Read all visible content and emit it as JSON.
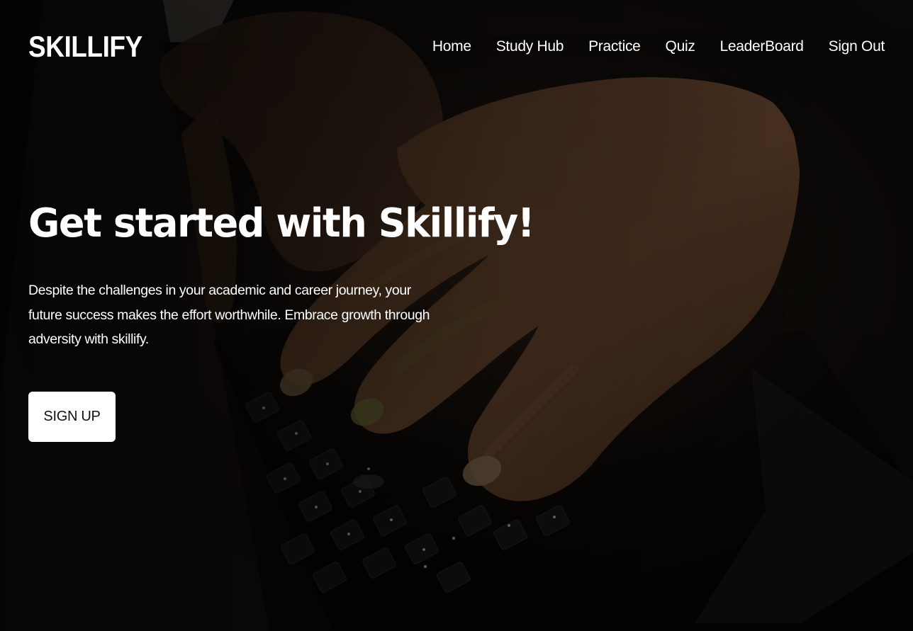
{
  "header": {
    "brand": "SKILLIFY",
    "nav": [
      {
        "label": "Home"
      },
      {
        "label": "Study Hub"
      },
      {
        "label": "Practice"
      },
      {
        "label": "Quiz"
      },
      {
        "label": "LeaderBoard"
      },
      {
        "label": "Sign Out"
      }
    ]
  },
  "hero": {
    "title": "Get started with Skillify!",
    "description": "Despite the challenges in your academic and career journey, your future success makes the effort worthwhile. Embrace growth through adversity with skillify.",
    "cta_label": "SIGN UP",
    "background_image": "hands-typing-on-laptop-keyboard",
    "colors": {
      "text": "#ffffff",
      "button_bg": "#ffffff",
      "button_text": "#111111",
      "overlay": "#0b0a09"
    }
  }
}
